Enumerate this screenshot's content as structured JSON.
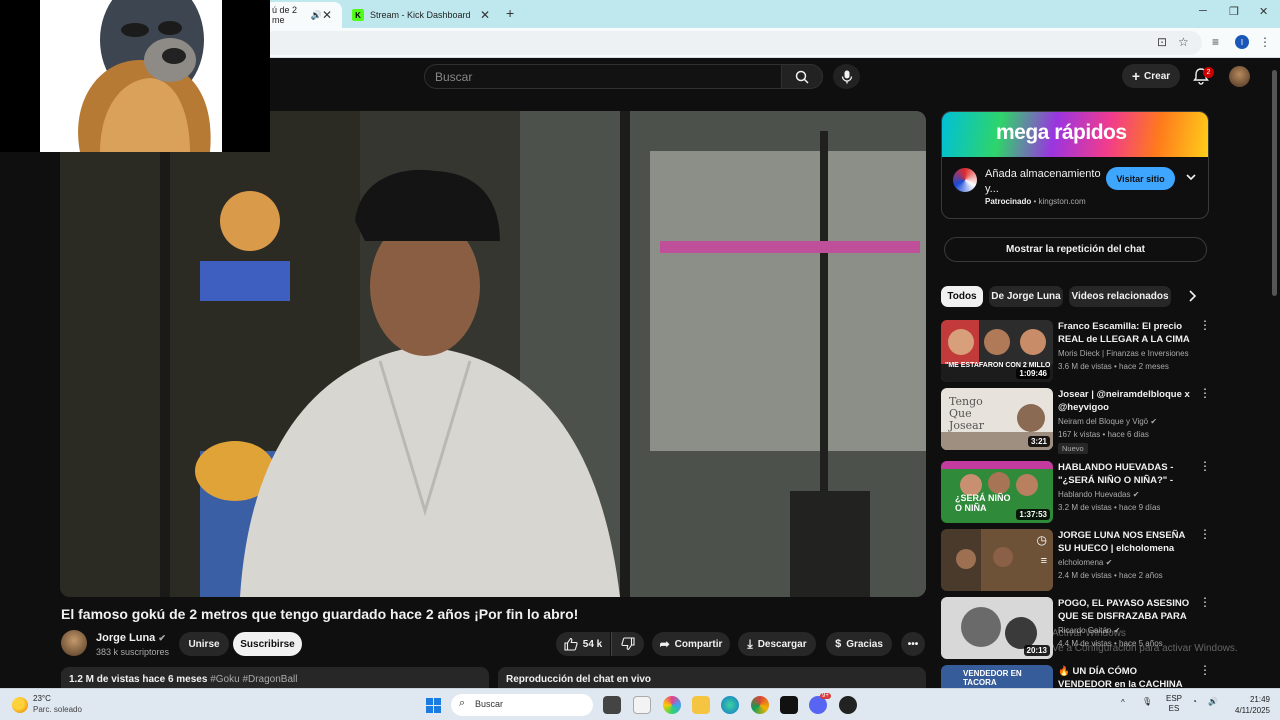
{
  "browser": {
    "tabs": [
      {
        "label": "ú de 2 me",
        "active": true
      },
      {
        "label": "Stream - Kick Dashboard",
        "active": false
      }
    ],
    "kick_favicon": "K",
    "profile_initial": "I"
  },
  "header": {
    "search_placeholder": "Buscar",
    "create_label": "Crear",
    "notification_count": "2"
  },
  "video": {
    "title": "El famoso gokú de 2 metros que tengo guardado hace 2 años ¡Por fin lo abro!",
    "channel_name": "Jorge Luna",
    "subscribers": "383 k suscriptores",
    "join_label": "Unirse",
    "subscribe_label": "Suscribirse",
    "likes": "54 k",
    "share_label": "Compartir",
    "download_label": "Descargar",
    "thanks_label": "Gracias",
    "description_meta": "1.2 M de vistas  hace 6 meses",
    "description_tags": "#Goku #DragonBall",
    "chat_replay_label": "Reproducción del chat en vivo"
  },
  "ad": {
    "banner_text": "mega rápidos",
    "title": "Añada almacenamiento y...",
    "sponsored_label": "Patrocinado",
    "domain": "kingston.com",
    "cta": "Visitar sitio"
  },
  "sidebar": {
    "chat_button": "Mostrar la repetición del chat",
    "chips": [
      "Todos",
      "De Jorge Luna",
      "Videos relacionados"
    ],
    "recommendations": [
      {
        "title": "Franco Escamilla: El precio REAL de LLEGAR A LA CIMA | ...",
        "channel": "Moris Dieck | Finanzas e Inversiones",
        "meta": "3.6 M de vistas • hace 2 meses",
        "duration": "1:09:46",
        "badge": "",
        "thumb_text": "\"ME ESTAFARON CON 2 MILLO"
      },
      {
        "title": "Josear | @neiramdelbloque x @heyvigoo",
        "channel": "Neiram del Bloque y Vigö",
        "meta": "167 k vistas • hace 6 días",
        "duration": "3:21",
        "badge": "Nuevo",
        "thumb_text": "Tengo Que Josear"
      },
      {
        "title": "HABLANDO HUEVADAS - \"¿SERÁ NIÑO O NIÑA?\" - PRE ...",
        "channel": "Hablando Huevadas",
        "meta": "3.2 M de vistas • hace 9 días",
        "duration": "1:37:53",
        "badge": "",
        "thumb_text": "¿SERÁ NIÑO O NIÑA"
      },
      {
        "title": "JORGE LUNA NOS ENSEÑA SU HUECO | elcholomena",
        "channel": "elcholomena",
        "meta": "2.4 M de vistas • hace 2 años",
        "duration": "",
        "badge": "",
        "thumb_text": ""
      },
      {
        "title": "POGO, EL PAYASO ASESINO QUE SE DISFRAZABA PARA ...",
        "channel": "Ricardo Gaitán",
        "meta": "4.4 M de vistas • hace 5 años",
        "duration": "20:13",
        "badge": "",
        "thumb_text": ""
      },
      {
        "title": "UN DÍA CÓMO VENDEDOR en la CACHINA MÁS GRANDE ...",
        "channel": "",
        "meta": "",
        "duration": "",
        "badge": "",
        "thumb_text": "VENDEDOR EN TACORA"
      }
    ]
  },
  "overlay": {
    "activate_line1": "Activar Windows",
    "activate_line2": "Ve a Configuración para activar Windows."
  },
  "taskbar": {
    "temperature": "23°C",
    "weather": "Parc. soleado",
    "search_label": "Buscar",
    "lang_top": "ESP",
    "lang_bottom": "ES",
    "time": "21:49",
    "date": "4/11/2025",
    "discord_badge": "9+"
  },
  "colors": {
    "background": "#0f0f0f",
    "accent_blue": "#3ea6ff",
    "badge_red": "#cc0000",
    "chrome_tabstrip": "#bfe8ee"
  }
}
